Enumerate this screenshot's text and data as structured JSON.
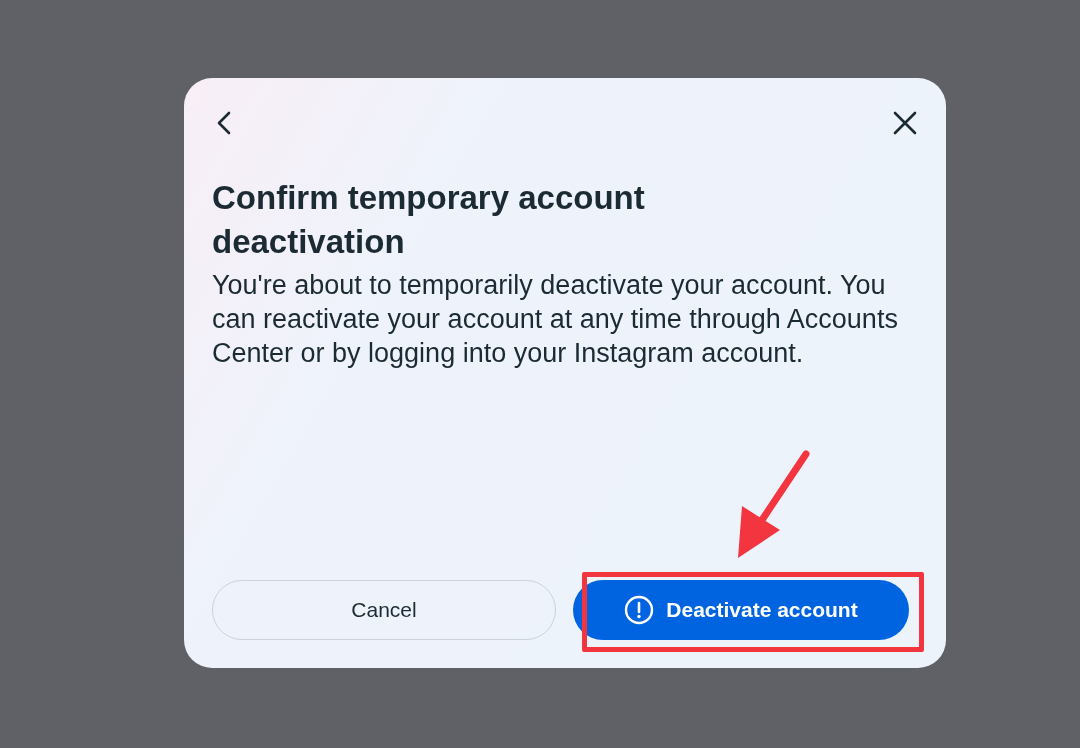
{
  "dialog": {
    "title": "Confirm temporary account deactivation",
    "message": "You're about to temporarily deactivate your account. You can reactivate your account at any time through Accounts Center or by logging into your Instagram account.",
    "buttons": [
      {
        "label": "Cancel",
        "kind": "secondary"
      },
      {
        "label": "Deactivate account",
        "kind": "primary"
      }
    ]
  }
}
